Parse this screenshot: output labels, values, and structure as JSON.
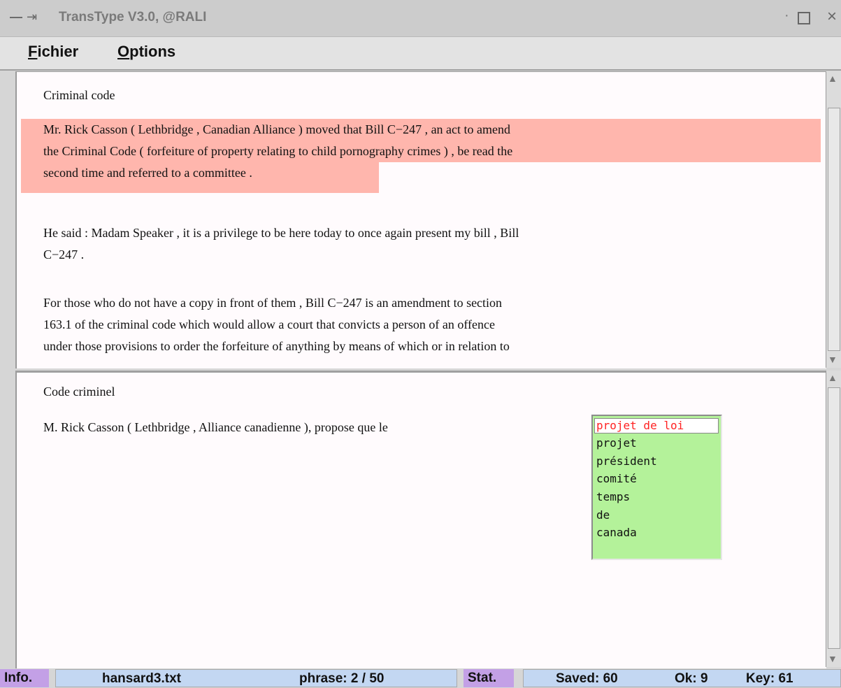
{
  "window": {
    "title": "TransType V3.0, @RALI"
  },
  "menu": {
    "file": {
      "accel": "F",
      "rest": "ichier"
    },
    "options": {
      "accel": "O",
      "rest": "ptions"
    }
  },
  "source": {
    "heading": "Criminal code",
    "para1_line1": "Mr. Rick Casson ( Lethbridge , Canadian Alliance ) moved that Bill C−247 , an act to amend",
    "para1_line2": "the Criminal Code ( forfeiture of property relating to child pornography crimes ) , be read the",
    "para1_line3": "second time and referred to a committee .",
    "para2_line1": "He said : Madam Speaker , it is a privilege to be here today to once again present my bill , Bill",
    "para2_line2": "C−247 .",
    "para3_line1": "For those who do not have a copy in front of them , Bill C−247 is an amendment to section",
    "para3_line2": "163.1 of the criminal code which would allow a court that convicts a person of an offence",
    "para3_line3": "under those provisions to order the forfeiture of anything by means of which or in relation to"
  },
  "target": {
    "heading": "Code criminel",
    "line": "M. Rick Casson ( Lethbridge , Alliance canadienne ), propose que le"
  },
  "completions": [
    "projet de loi",
    "projet",
    "président",
    "comité",
    "temps",
    "de",
    "canada"
  ],
  "status": {
    "info_label": "Info.",
    "file": "hansard3.txt",
    "phrase": "phrase: 2 / 50",
    "stat_label": "Stat.",
    "saved": "Saved: 60",
    "ok": "Ok: 9",
    "key": "Key: 61"
  },
  "colors": {
    "highlight": "#ffb6ad",
    "popup_bg": "#b4f29a",
    "selected_text": "#ff2222",
    "status_label": "#c3a0e6",
    "status_field": "#c3d7f2"
  }
}
